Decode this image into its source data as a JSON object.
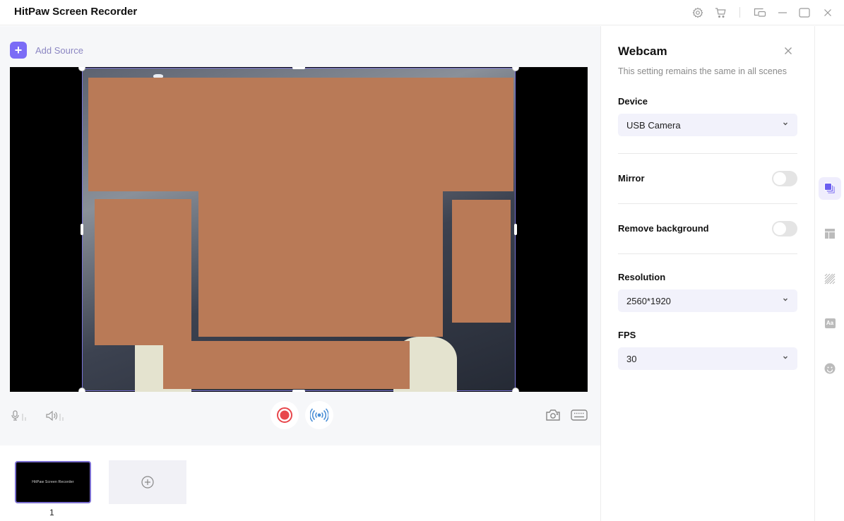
{
  "app": {
    "title": "HitPaw Screen Recorder"
  },
  "titlebar": {
    "icons": [
      "settings-icon",
      "cart-icon",
      "mini-mode-icon",
      "minimize-icon",
      "maximize-icon",
      "close-icon"
    ]
  },
  "main": {
    "add_source_label": "Add Source",
    "add_source_icon": "+",
    "controls": {
      "left": [
        "microphone-icon",
        "speaker-icon"
      ],
      "center": [
        "record-icon",
        "live-stream-icon"
      ],
      "right": [
        "screenshot-camera-icon",
        "keyboard-icon"
      ]
    }
  },
  "scenes": {
    "items": [
      {
        "number": "1",
        "thumb_text": "HitPaw Screen Recorder",
        "selected": true
      }
    ],
    "add_icon": "add-scene-icon"
  },
  "panel": {
    "title": "Webcam",
    "subtitle": "This setting remains the same in all scenes",
    "device": {
      "label": "Device",
      "value": "USB Camera"
    },
    "mirror": {
      "label": "Mirror",
      "on": false
    },
    "remove_background": {
      "label": "Remove background",
      "on": false
    },
    "resolution": {
      "label": "Resolution",
      "value": "2560*1920"
    },
    "fps": {
      "label": "FPS",
      "value": "30"
    }
  },
  "rail": {
    "items": [
      {
        "name": "layers-icon",
        "active": true
      },
      {
        "name": "layout-icon",
        "active": false
      },
      {
        "name": "background-pattern-icon",
        "active": false
      },
      {
        "name": "text-icon",
        "active": false,
        "glyph": "Aa"
      },
      {
        "name": "sticker-icon",
        "active": false
      }
    ]
  },
  "colors": {
    "accent": "#7b6cf6",
    "record": "#e8474c",
    "stream": "#4b8fd6",
    "redaction": "#b97a57"
  }
}
